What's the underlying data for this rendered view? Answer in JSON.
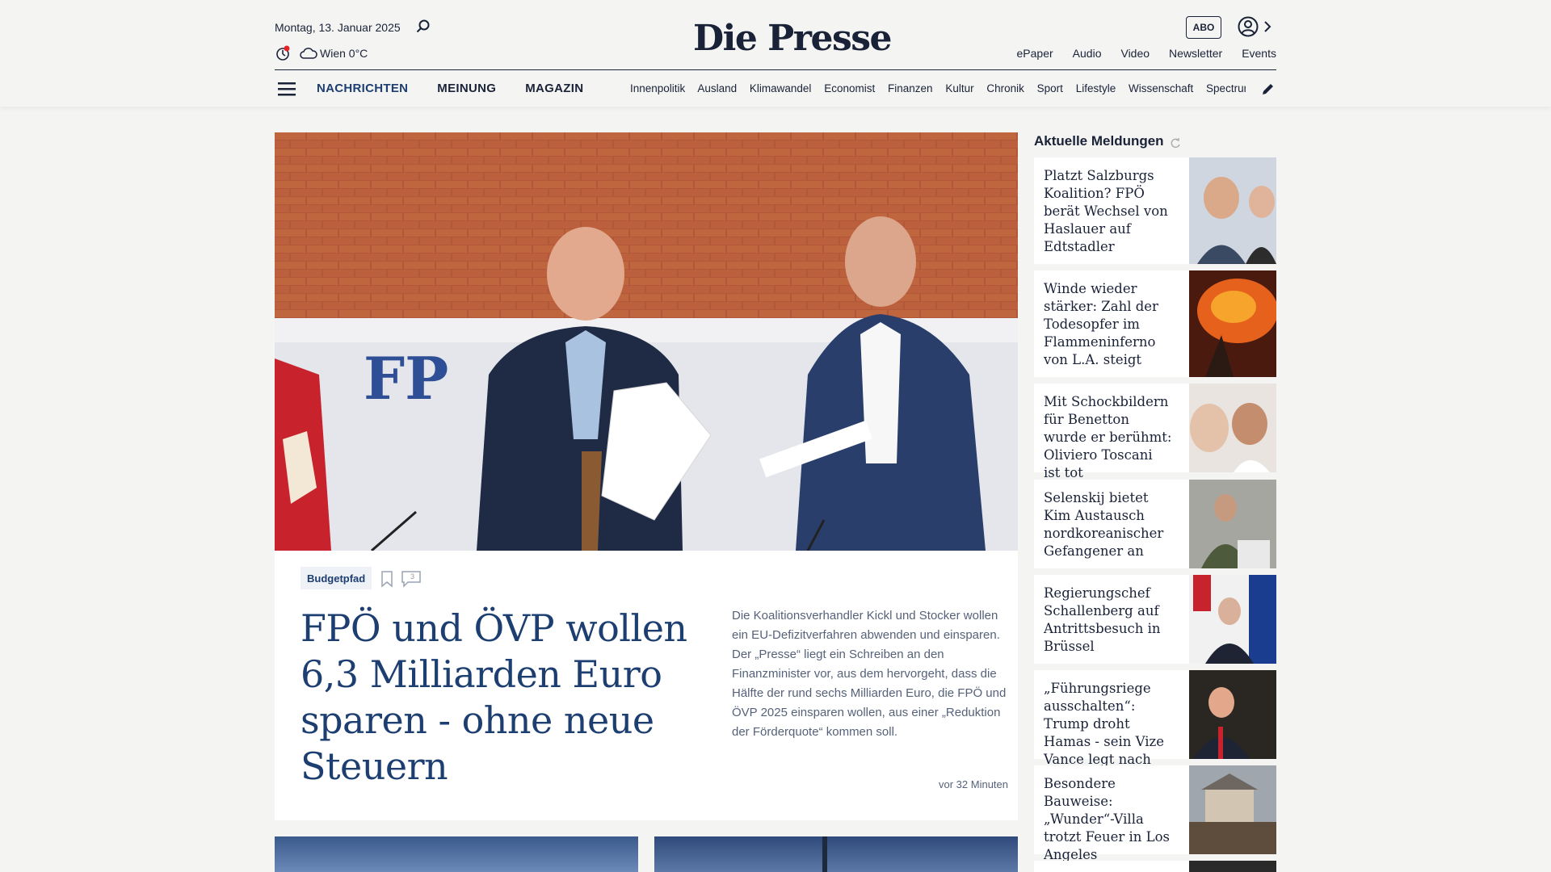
{
  "header": {
    "date": "Montag, 13. Januar 2025",
    "weather": "Wien 0°C",
    "logo": "Die Presse",
    "abo_label": "ABO",
    "top_menu": [
      "ePaper",
      "Audio",
      "Video",
      "Newsletter",
      "Events"
    ],
    "main_nav": [
      "NACHRICHTEN",
      "MEINUNG",
      "MAGAZIN"
    ],
    "sub_nav": [
      "Innenpolitik",
      "Ausland",
      "Klimawandel",
      "Economist",
      "Finanzen",
      "Kultur",
      "Chronik",
      "Sport",
      "Lifestyle",
      "Wissenschaft",
      "Spectrum"
    ]
  },
  "hero": {
    "tag": "Budgetpfad",
    "comment_count": "3",
    "headline": "FPÖ und ÖVP wollen 6,3 Milliarden Euro sparen - ohne neue Steuern",
    "teaser": "Die Koalitionsverhandler Kickl und Stocker wollen ein EU-Defizitverfahren abwenden und einsparen. Der „Presse“ liegt ein Schreiben an den Finanzminister vor, aus dem hervorgeht, dass die Hälfte der rund sechs Milliarden Euro, die FPÖ und ÖVP 2025 einsparen wollen, aus einer „Reduktion der Förderquote“ kommen soll.",
    "age": "vor 32 Minuten"
  },
  "sidebar": {
    "title": "Aktuelle Meldungen",
    "items": [
      {
        "title": "Platzt Salzburgs Koalition? FPÖ berät Wechsel von Haslauer auf Edtstadler"
      },
      {
        "title": "Winde wieder stärker: Zahl der Todesopfer im Flammeninferno von L.A. steigt"
      },
      {
        "title": "Mit Schockbildern für Benetton wurde er berühmt: Oliviero Toscani ist tot"
      },
      {
        "title": "Selenskij bietet Kim Austausch nordkoreanischer Gefangener an"
      },
      {
        "title": "Regierungschef Schallenberg auf Antrittsbesuch in Brüssel"
      },
      {
        "title": "„Führungsriege ausschalten“: Trump droht Hamas - sein Vize Vance legt nach"
      },
      {
        "title": "Besondere Bauweise: „Wunder“-Villa trotzt Feuer in Los Angeles"
      }
    ]
  },
  "colors": {
    "brand": "#1a2238",
    "accent": "#1d3e70",
    "background": "#f4f4f2",
    "notification": "#e3242b"
  }
}
